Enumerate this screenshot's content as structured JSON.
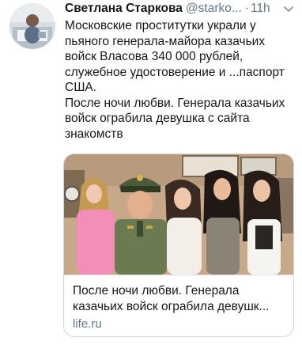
{
  "author": {
    "name": "Светлана Старкова",
    "handle": "@starko...",
    "separator": "·",
    "time": "11h"
  },
  "tweet": {
    "paragraph_1": "Московские проститутки украли у пьяного генерала-майора казачьих войск Власова 340 000 рублей, служебное удостоверение и ...паспорт США.",
    "paragraph_2": "После ночи любви. Генерала казачьих войск ограбила девушка с сайта знакомств"
  },
  "card": {
    "title": "После ночи любви. Генерала казачьих войск ограбила девушк...",
    "domain": "life.ru"
  },
  "icons": {
    "menu": "chevron-down-icon",
    "avatar": "avatar-image",
    "card_image": "photo-image"
  }
}
